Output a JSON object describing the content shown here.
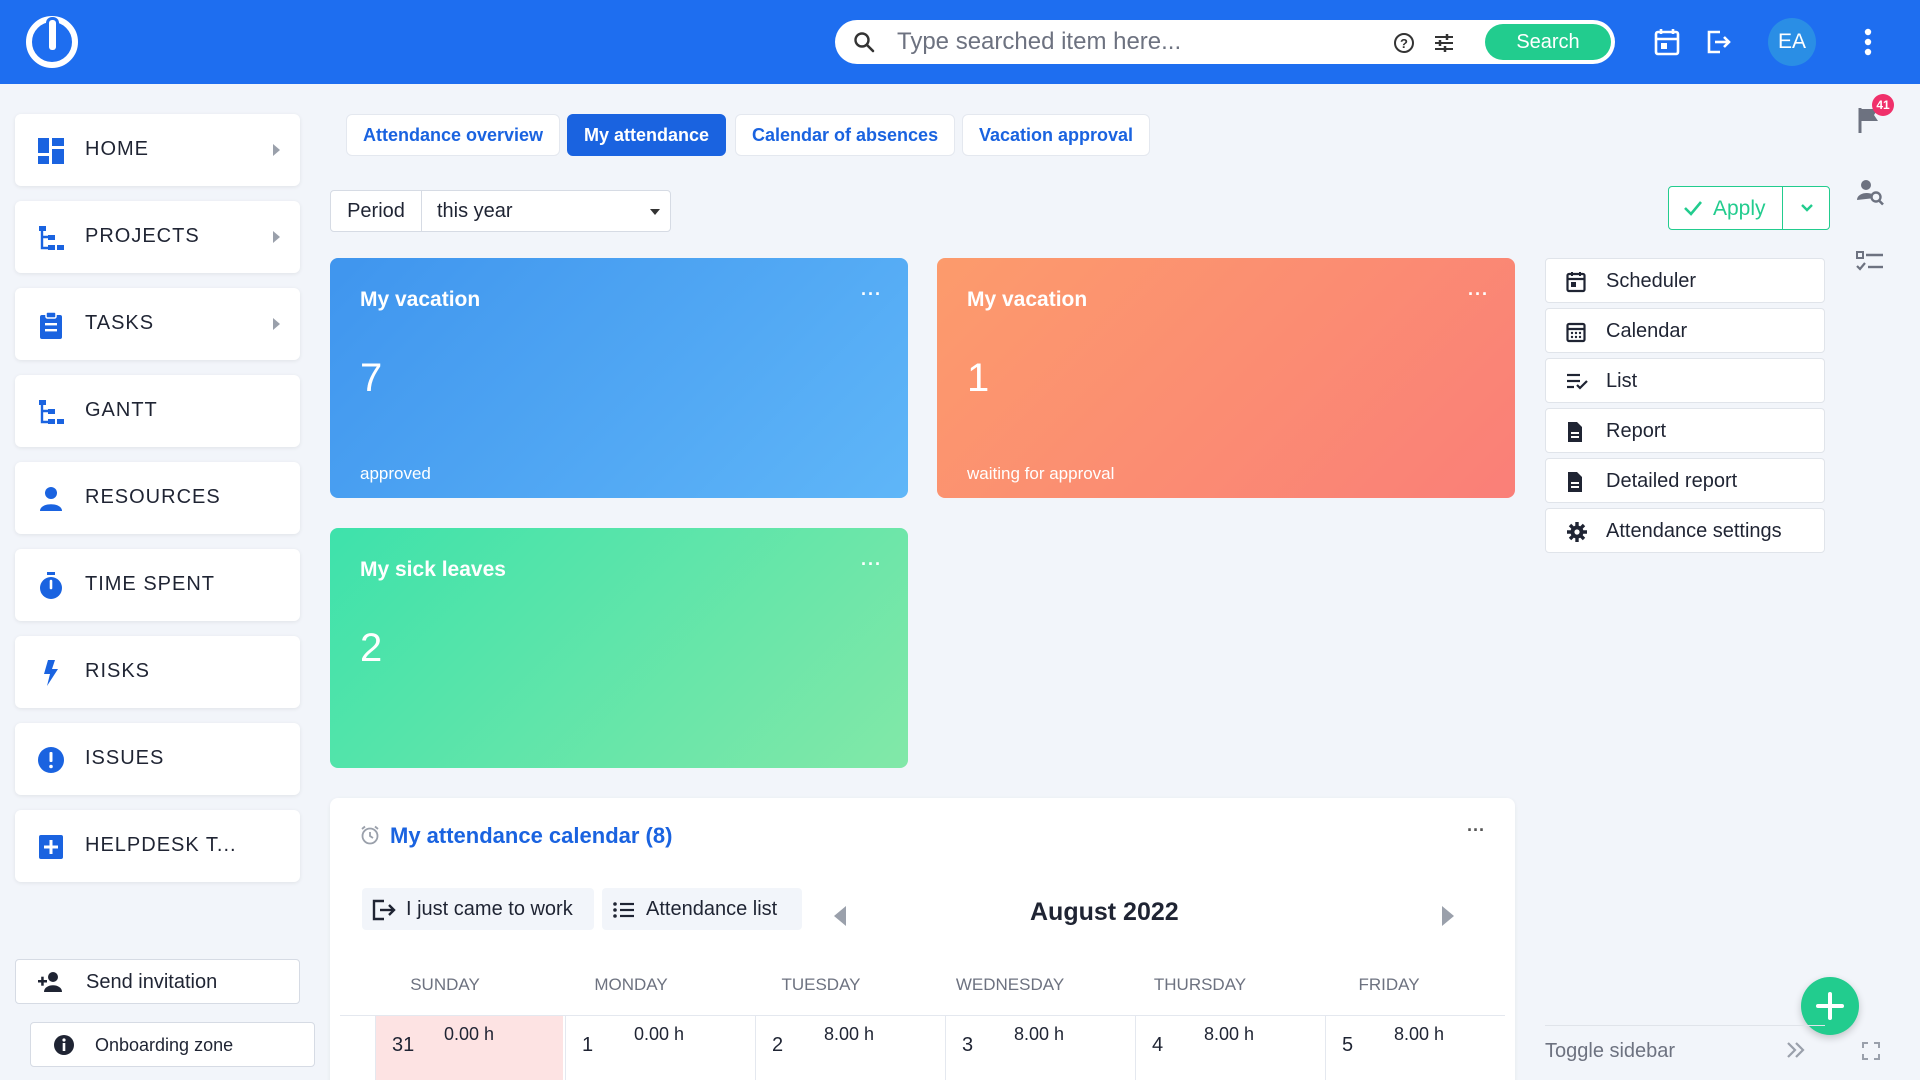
{
  "header": {
    "search_placeholder": "Type searched item here...",
    "search_button": "Search",
    "avatar_initials": "EA"
  },
  "sidebar": {
    "items": [
      {
        "label": "HOME",
        "icon": "dashboard-icon",
        "has_arrow": true
      },
      {
        "label": "PROJECTS",
        "icon": "tree-icon",
        "has_arrow": true
      },
      {
        "label": "TASKS",
        "icon": "clipboard-icon",
        "has_arrow": true
      },
      {
        "label": "GANTT",
        "icon": "gantt-icon",
        "has_arrow": false
      },
      {
        "label": "RESOURCES",
        "icon": "person-icon",
        "has_arrow": false
      },
      {
        "label": "TIME SPENT",
        "icon": "stopwatch-icon",
        "has_arrow": false
      },
      {
        "label": "RISKS",
        "icon": "lightning-icon",
        "has_arrow": false
      },
      {
        "label": "ISSUES",
        "icon": "alert-circle-icon",
        "has_arrow": false
      },
      {
        "label": "HELPDESK T...",
        "icon": "plus-box-icon",
        "has_arrow": false
      }
    ],
    "send_invitation": "Send invitation",
    "onboarding_zone": "Onboarding zone"
  },
  "tabs": [
    {
      "label": "Attendance overview",
      "active": false
    },
    {
      "label": "My attendance",
      "active": true
    },
    {
      "label": "Calendar of absences",
      "active": false
    },
    {
      "label": "Vacation approval",
      "active": false
    }
  ],
  "filter": {
    "period_label": "Period",
    "period_value": "this year",
    "apply_label": "Apply"
  },
  "cards": [
    {
      "title": "My vacation",
      "value": "7",
      "subtitle": "approved",
      "more": "···",
      "gradient": [
        "#3f95ee",
        "#5fb6f8"
      ]
    },
    {
      "title": "My vacation",
      "value": "1",
      "subtitle": "waiting for approval",
      "more": "···",
      "gradient": [
        "#fc9b6c",
        "#fa7f78"
      ]
    },
    {
      "title": "My sick leaves",
      "value": "2",
      "subtitle": "",
      "more": "···",
      "gradient": [
        "#3ee2ab",
        "#82e8a8"
      ]
    }
  ],
  "quick_links": [
    {
      "label": "Scheduler",
      "icon": "calendar-day-icon"
    },
    {
      "label": "Calendar",
      "icon": "calendar-grid-icon"
    },
    {
      "label": "List",
      "icon": "list-check-icon"
    },
    {
      "label": "Report",
      "icon": "document-icon"
    },
    {
      "label": "Detailed report",
      "icon": "document-icon"
    },
    {
      "label": "Attendance settings",
      "icon": "gear-icon"
    }
  ],
  "right_rail": {
    "notification_count": "41"
  },
  "calendar": {
    "title": "My attendance calendar (8)",
    "more": "···",
    "came_to_work": "I just came to work",
    "attendance_list": "Attendance list",
    "month": "August 2022",
    "days": [
      "SUNDAY",
      "MONDAY",
      "TUESDAY",
      "WEDNESDAY",
      "THURSDAY",
      "FRIDAY"
    ],
    "cells": [
      {
        "day": "31",
        "hours": "0.00 h",
        "highlight": true
      },
      {
        "day": "1",
        "hours": "0.00 h",
        "highlight": false
      },
      {
        "day": "2",
        "hours": "8.00 h",
        "highlight": false
      },
      {
        "day": "3",
        "hours": "8.00 h",
        "highlight": false
      },
      {
        "day": "4",
        "hours": "8.00 h",
        "highlight": false
      },
      {
        "day": "5",
        "hours": "8.00 h",
        "highlight": false
      }
    ]
  },
  "footer": {
    "toggle_sidebar": "Toggle sidebar"
  },
  "colors": {
    "brand": "#1e6ef0",
    "accent_green": "#22cc8e",
    "link_blue": "#1a63e0",
    "weekend_highlight": "#fde3e3"
  }
}
